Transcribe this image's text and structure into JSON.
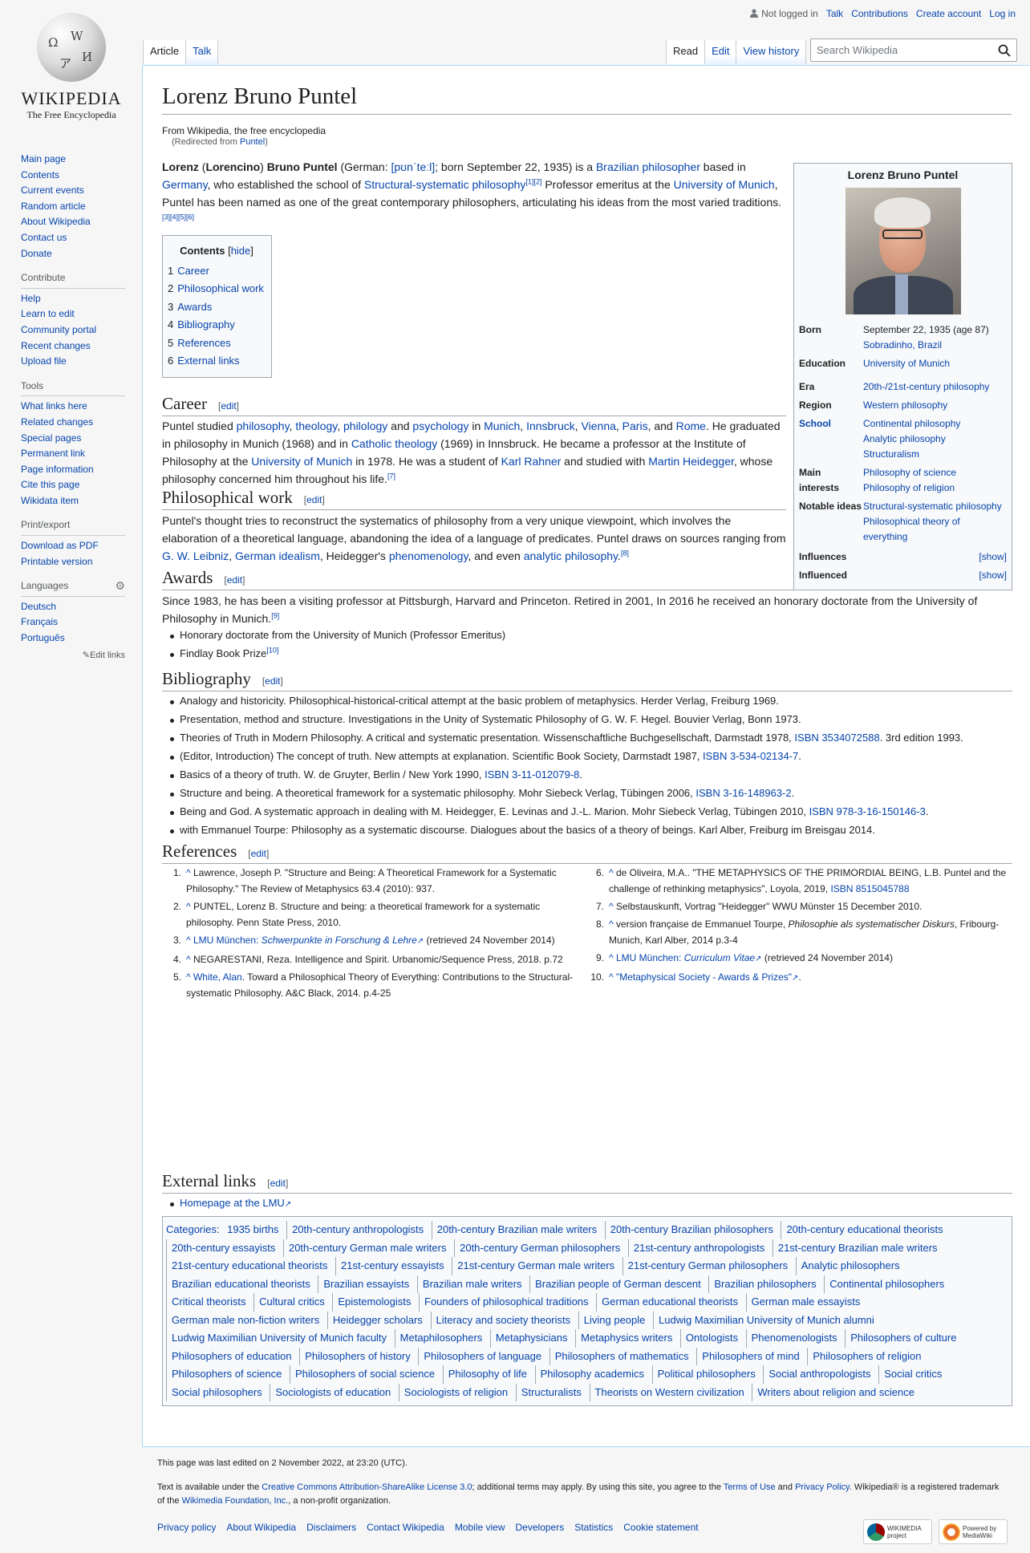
{
  "logo": {
    "wordmark": "WIKIPEDIA",
    "tagline": "The Free Encyclopedia"
  },
  "sidebar": {
    "main": [
      "Main page",
      "Contents",
      "Current events",
      "Random article",
      "About Wikipedia",
      "Contact us",
      "Donate"
    ],
    "contribute_h": "Contribute",
    "contribute": [
      "Help",
      "Learn to edit",
      "Community portal",
      "Recent changes",
      "Upload file"
    ],
    "tools_h": "Tools",
    "tools": [
      "What links here",
      "Related changes",
      "Special pages",
      "Permanent link",
      "Page information",
      "Cite this page",
      "Wikidata item"
    ],
    "print_h": "Print/export",
    "print": [
      "Download as PDF",
      "Printable version"
    ],
    "lang_h": "Languages",
    "langs": [
      "Deutsch",
      "Français",
      "Português"
    ],
    "edit_links": "Edit links"
  },
  "personal": {
    "not_logged": "Not logged in",
    "talk": "Talk",
    "contributions": "Contributions",
    "create": "Create account",
    "login": "Log in"
  },
  "tabs": {
    "article": "Article",
    "talk": "Talk",
    "read": "Read",
    "edit": "Edit",
    "history": "View history"
  },
  "search": {
    "placeholder": "Search Wikipedia"
  },
  "page": {
    "title": "Lorenz Bruno Puntel",
    "from": "From Wikipedia, the free encyclopedia",
    "redirected": "(Redirected from ",
    "redirect_link": "Puntel",
    "redirect_end": ")"
  },
  "lead": {
    "b1": "Lorenz",
    "t1": " (",
    "b2": "Lorencino",
    "t2": ") ",
    "b3": "Bruno Puntel",
    "t3": " (German: ",
    "ipa": "[pʊnˈteːl]",
    "t4": "; born September 22, 1935) is a ",
    "l1": "Brazilian philosopher",
    "t5": " based in ",
    "l2": "Germany",
    "t6": ", who established the school of ",
    "l3": "Structural-systematic philosophy",
    "s1": "[1]",
    "s2": "[2]",
    "t7": " Professor emeritus at the ",
    "l4": "University of Munich",
    "t8": ", Puntel has been named as one of the great contemporary philosophers, articulating his ideas from the most varied traditions.",
    "s3": "[3]",
    "s4": "[4]",
    "s5": "[5]",
    "s6": "[6]"
  },
  "toc": {
    "title": "Contents",
    "hide": "hide",
    "items": [
      [
        "1",
        "Career"
      ],
      [
        "2",
        "Philosophical work"
      ],
      [
        "3",
        "Awards"
      ],
      [
        "4",
        "Bibliography"
      ],
      [
        "5",
        "References"
      ],
      [
        "6",
        "External links"
      ]
    ]
  },
  "infobox": {
    "title": "Lorenz Bruno Puntel",
    "born_l": "Born",
    "born": "September 22, 1935 (age 87)",
    "born_place": "Sobradinho, Brazil",
    "edu_l": "Education",
    "edu": "University of Munich",
    "era_l": "Era",
    "era": "20th-/21st-century philosophy",
    "region_l": "Region",
    "region": "Western philosophy",
    "school_l": "School",
    "school": [
      "Continental philosophy",
      "Analytic philosophy",
      "Structuralism"
    ],
    "interests_l": "Main interests",
    "interests": [
      "Philosophy of science",
      "Philosophy of religion"
    ],
    "ideas_l": "Notable ideas",
    "ideas": [
      "Structural-systematic philosophy",
      "Philosophical theory of everything"
    ],
    "influences_l": "Influences",
    "influenced_l": "Influenced",
    "show": "[show]"
  },
  "edit": "edit",
  "career": {
    "h": "Career",
    "t1": "Puntel studied ",
    "l1": "philosophy",
    "c1": ", ",
    "l2": "theology",
    "c2": ", ",
    "l3": "philology",
    "t2": " and ",
    "l4": "psychology",
    "t3": " in ",
    "l5": "Munich",
    "c3": ", ",
    "l6": "Innsbruck",
    "c4": ", ",
    "l7": "Vienna",
    "c5": ", ",
    "l8": "Paris",
    "t4": ", and ",
    "l9": "Rome",
    "t5": ". He graduated in philosophy in Munich (1968) and in ",
    "l10": "Catholic theology",
    "t6": " (1969) in Innsbruck. He became a professor at the Institute of Philosophy at the ",
    "l11": "University of Munich",
    "t7": " in 1978. He was a student of ",
    "l12": "Karl Rahner",
    "t8": " and studied with ",
    "l13": "Martin Heidegger",
    "t9": ", whose philosophy concerned him throughout his life.",
    "s": "[7]"
  },
  "phil": {
    "h": "Philosophical work",
    "t1": "Puntel's thought tries to reconstruct the systematics of philosophy from a very unique viewpoint, which involves the elaboration of a theoretical language, abandoning the idea of a language of predicates. Puntel draws on sources ranging from ",
    "l1": "G. W. Leibniz",
    "c1": ", ",
    "l2": "German idealism",
    "t2": ", Heidegger's ",
    "l3": "phenomenology",
    "t3": ", and even ",
    "l4": "analytic philosophy",
    "t4": ".",
    "s": "[8]"
  },
  "awards": {
    "h": "Awards",
    "p": "Since 1983, he has been a visiting professor at Pittsburgh, Harvard and Princeton. Retired in 2001, In 2016 he received an honorary doctorate from the University of Philosophy in Munich.",
    "s": "[9]",
    "i1": "Honorary doctorate from the University of Munich (Professor Emeritus)",
    "i2": "Findlay Book Prize",
    "s2": "[10]"
  },
  "biblio": {
    "h": "Bibliography",
    "items": [
      {
        "t": "Analogy and historicity. Philosophical-historical-critical attempt at the basic problem of metaphysics. Herder Verlag, Freiburg 1969.",
        "i": "",
        "e": ""
      },
      {
        "t": "Presentation, method and structure. Investigations in the Unity of Systematic Philosophy of G. W. F. Hegel. Bouvier Verlag, Bonn 1973.",
        "i": "",
        "e": ""
      },
      {
        "t": "Theories of Truth in Modern Philosophy. A critical and systematic presentation. Wissenschaftliche Buchgesellschaft, Darmstadt 1978, ",
        "i": "ISBN 3534072588",
        "e": ". 3rd edition 1993."
      },
      {
        "t": "(Editor, Introduction) The concept of truth. New attempts at explanation. Scientific Book Society, Darmstadt 1987, ",
        "i": "ISBN 3-534-02134-7",
        "e": "."
      },
      {
        "t": "Basics of a theory of truth. W. de Gruyter, Berlin / New York 1990, ",
        "i": "ISBN 3-11-012079-8",
        "e": "."
      },
      {
        "t": "Structure and being. A theoretical framework for a systematic philosophy. Mohr Siebeck Verlag, Tübingen 2006, ",
        "i": "ISBN 3-16-148963-2",
        "e": "."
      },
      {
        "t": "Being and God. A systematic approach in dealing with M. Heidegger, E. Levinas and J.-L. Marion. Mohr Siebeck Verlag, Tübingen 2010, ",
        "i": "ISBN 978-3-16-150146-3",
        "e": "."
      },
      {
        "t": "with Emmanuel Tourpe: Philosophy as a systematic discourse. Dialogues about the basics of a theory of beings. Karl Alber, Freiburg im Breisgau 2014.",
        "i": "",
        "e": ""
      }
    ]
  },
  "refs": {
    "h": "References",
    "caret": "^",
    "r1": "Lawrence, Joseph P. \"Structure and Being: A Theoretical Framework for a Systematic Philosophy.\" The Review of Metaphysics 63.4 (2010): 937.",
    "r2": "PUNTEL, Lorenz B. Structure and being: a theoretical framework for a systematic philosophy. Penn State Press, 2010.",
    "r3a": "LMU München: ",
    "r3b": "Schwerpunkte in Forschung & Lehre",
    "r3c": " (retrieved 24 November 2014)",
    "r4": "NEGARESTANI, Reza. Intelligence and Spirit. Urbanomic/Sequence Press, 2018. p.72",
    "r5a": "White, Alan",
    "r5b": ". Toward a Philosophical Theory of Everything: Contributions to the Structural-systematic Philosophy. A&C Black, 2014. p.4-25",
    "r6a": "de Oliveira, M.A.. \"THE METAPHYSICS OF THE PRIMORDIAL BEING, L.B. Puntel and the challenge of rethinking metaphysics\", Loyola, 2019, ",
    "r6b": "ISBN 8515045788",
    "r7": "Selbstauskunft, Vortrag \"Heidegger\" WWU Münster 15 December 2010.",
    "r8a": "version française de Emmanuel Tourpe, ",
    "r8b": "Philosophie als systematischer Diskurs",
    "r8c": ", Fribourg- Munich, Karl Alber, 2014 p.3-4",
    "r9a": "LMU München: ",
    "r9b": "Curriculum Vitae",
    "r9c": " (retrieved 24 November 2014)",
    "r10a": "\"Metaphysical Society - Awards & Prizes\"",
    "r10b": "."
  },
  "ext": {
    "h": "External links",
    "link": "Homepage at the LMU"
  },
  "cats": {
    "label": "Categories",
    "items": [
      "1935 births",
      "20th-century anthropologists",
      "20th-century Brazilian male writers",
      "20th-century Brazilian philosophers",
      "20th-century educational theorists",
      "20th-century essayists",
      "20th-century German male writers",
      "20th-century German philosophers",
      "21st-century anthropologists",
      "21st-century Brazilian male writers",
      "21st-century educational theorists",
      "21st-century essayists",
      "21st-century German male writers",
      "21st-century German philosophers",
      "Analytic philosophers",
      "Brazilian educational theorists",
      "Brazilian essayists",
      "Brazilian male writers",
      "Brazilian people of German descent",
      "Brazilian philosophers",
      "Continental philosophers",
      "Critical theorists",
      "Cultural critics",
      "Epistemologists",
      "Founders of philosophical traditions",
      "German educational theorists",
      "German male essayists",
      "German male non-fiction writers",
      "Heidegger scholars",
      "Literacy and society theorists",
      "Living people",
      "Ludwig Maximilian University of Munich alumni",
      "Ludwig Maximilian University of Munich faculty",
      "Metaphilosophers",
      "Metaphysicians",
      "Metaphysics writers",
      "Ontologists",
      "Phenomenologists",
      "Philosophers of culture",
      "Philosophers of education",
      "Philosophers of history",
      "Philosophers of language",
      "Philosophers of mathematics",
      "Philosophers of mind",
      "Philosophers of religion",
      "Philosophers of science",
      "Philosophers of social science",
      "Philosophy of life",
      "Philosophy academics",
      "Political philosophers",
      "Social anthropologists",
      "Social critics",
      "Social philosophers",
      "Sociologists of education",
      "Sociologists of religion",
      "Structuralists",
      "Theorists on Western civilization",
      "Writers about religion and science"
    ]
  },
  "footer": {
    "last": "This page was last edited on 2 November 2022, at 23:20 (UTC).",
    "lic1": "Text is available under the ",
    "lic_link": "Creative Commons Attribution-ShareAlike License 3.0",
    "lic2": "; additional terms may apply. By using this site, you agree to the ",
    "tou": "Terms of Use",
    "and": " and ",
    "pp": "Privacy Policy",
    "lic3": ". Wikipedia® is a registered trademark of the ",
    "wmf": "Wikimedia Foundation, Inc.",
    "lic4": ", a non-profit organization.",
    "links": [
      "Privacy policy",
      "About Wikipedia",
      "Disclaimers",
      "Contact Wikipedia",
      "Mobile view",
      "Developers",
      "Statistics",
      "Cookie statement"
    ],
    "badge1": "WIKIMEDIA project",
    "badge2": "Powered by MediaWiki"
  }
}
